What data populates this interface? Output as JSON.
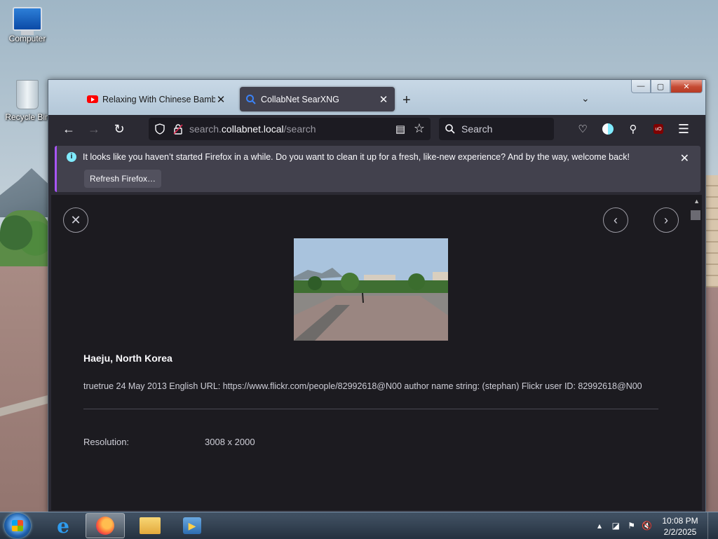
{
  "desktop": {
    "icons": [
      {
        "label": "Computer",
        "name": "computer"
      },
      {
        "label": "Recycle Bin",
        "name": "recycle-bin"
      }
    ]
  },
  "browser": {
    "tabs": [
      {
        "label": "Relaxing With Chinese Bamboo",
        "icon": "youtube-icon",
        "active": false
      },
      {
        "label": "CollabNet SearXNG",
        "icon": "search-icon",
        "active": true
      }
    ],
    "url": {
      "prefix": "search.",
      "domain": "collabnet.local",
      "path": "/search"
    },
    "search_placeholder": "Search",
    "notification": {
      "message": "It looks like you haven’t started Firefox in a while. Do you want to clean it up for a fresh, like-new experience? And by the way, welcome back!",
      "button": "Refresh Firefox…"
    }
  },
  "result": {
    "title": "Haeju, North Korea",
    "description": "truetrue 24 May 2013 English URL: https://www.flickr.com/people/82992618@N00 author name string: (stephan) Flickr user ID: 82992618@N00",
    "resolution_label": "Resolution:",
    "resolution_value": "3008 x 2000"
  },
  "taskbar": {
    "time": "10:08 PM",
    "date": "2/2/2025"
  },
  "colors": {
    "firefox_bg": "#2b2a33",
    "content_bg": "#1c1b20",
    "notif_bg": "#42414d",
    "accent": "#80ebff"
  }
}
